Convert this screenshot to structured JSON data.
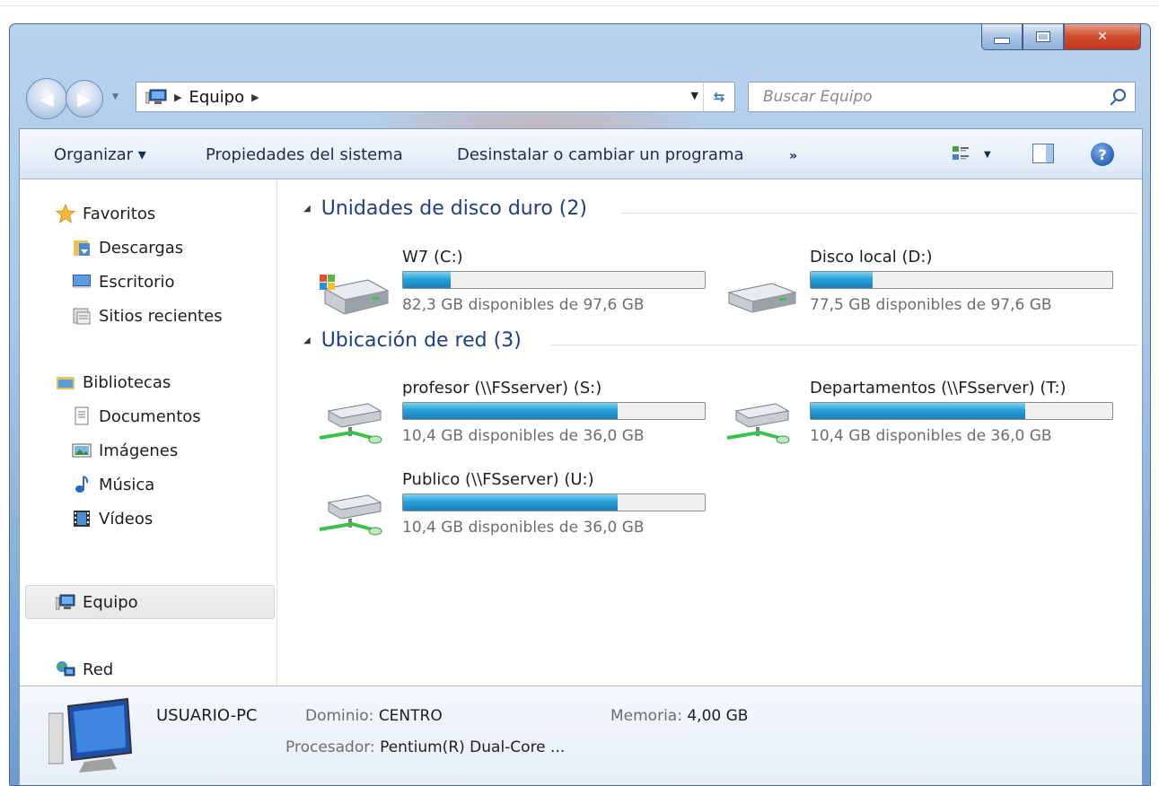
{
  "address_bar": {
    "location": "Equipo"
  },
  "search": {
    "placeholder": "Buscar Equipo"
  },
  "toolbar": {
    "organize": "Organizar ▾",
    "system_properties": "Propiedades del sistema",
    "uninstall": "Desinstalar o cambiar un programa",
    "more": "»"
  },
  "sidebar": {
    "favorites": "Favoritos",
    "downloads": "Descargas",
    "desktop": "Escritorio",
    "recent": "Sitios recientes",
    "libraries": "Bibliotecas",
    "documents": "Documentos",
    "pictures": "Imágenes",
    "music": "Música",
    "videos": "Vídeos",
    "computer": "Equipo",
    "network": "Red"
  },
  "groups": {
    "hard_drives": "Unidades de disco duro (2)",
    "network_locations": "Ubicación de red (3)"
  },
  "drives": [
    {
      "name": "W7 (C:)",
      "free_text": "82,3 GB disponibles de 97,6 GB",
      "used_fraction": 0.157
    },
    {
      "name": "Disco local (D:)",
      "free_text": "77,5 GB disponibles de 97,6 GB",
      "used_fraction": 0.206
    },
    {
      "name": "profesor (\\\\FSserver) (S:)",
      "free_text": "10,4 GB disponibles de 36,0 GB",
      "used_fraction": 0.711
    },
    {
      "name": "Departamentos (\\\\FSserver) (T:)",
      "free_text": "10,4 GB disponibles de 36,0 GB",
      "used_fraction": 0.711
    },
    {
      "name": "Publico (\\\\FSserver) (U:)",
      "free_text": "10,4 GB disponibles de 36,0 GB",
      "used_fraction": 0.711
    }
  ],
  "details": {
    "computer_name": "USUARIO-PC",
    "domain_label": "Dominio:",
    "domain_value": "CENTRO",
    "memory_label": "Memoria:",
    "memory_value": "4,00 GB",
    "processor_label": "Procesador:",
    "processor_value": "Pentium(R) Dual-Core ..."
  }
}
